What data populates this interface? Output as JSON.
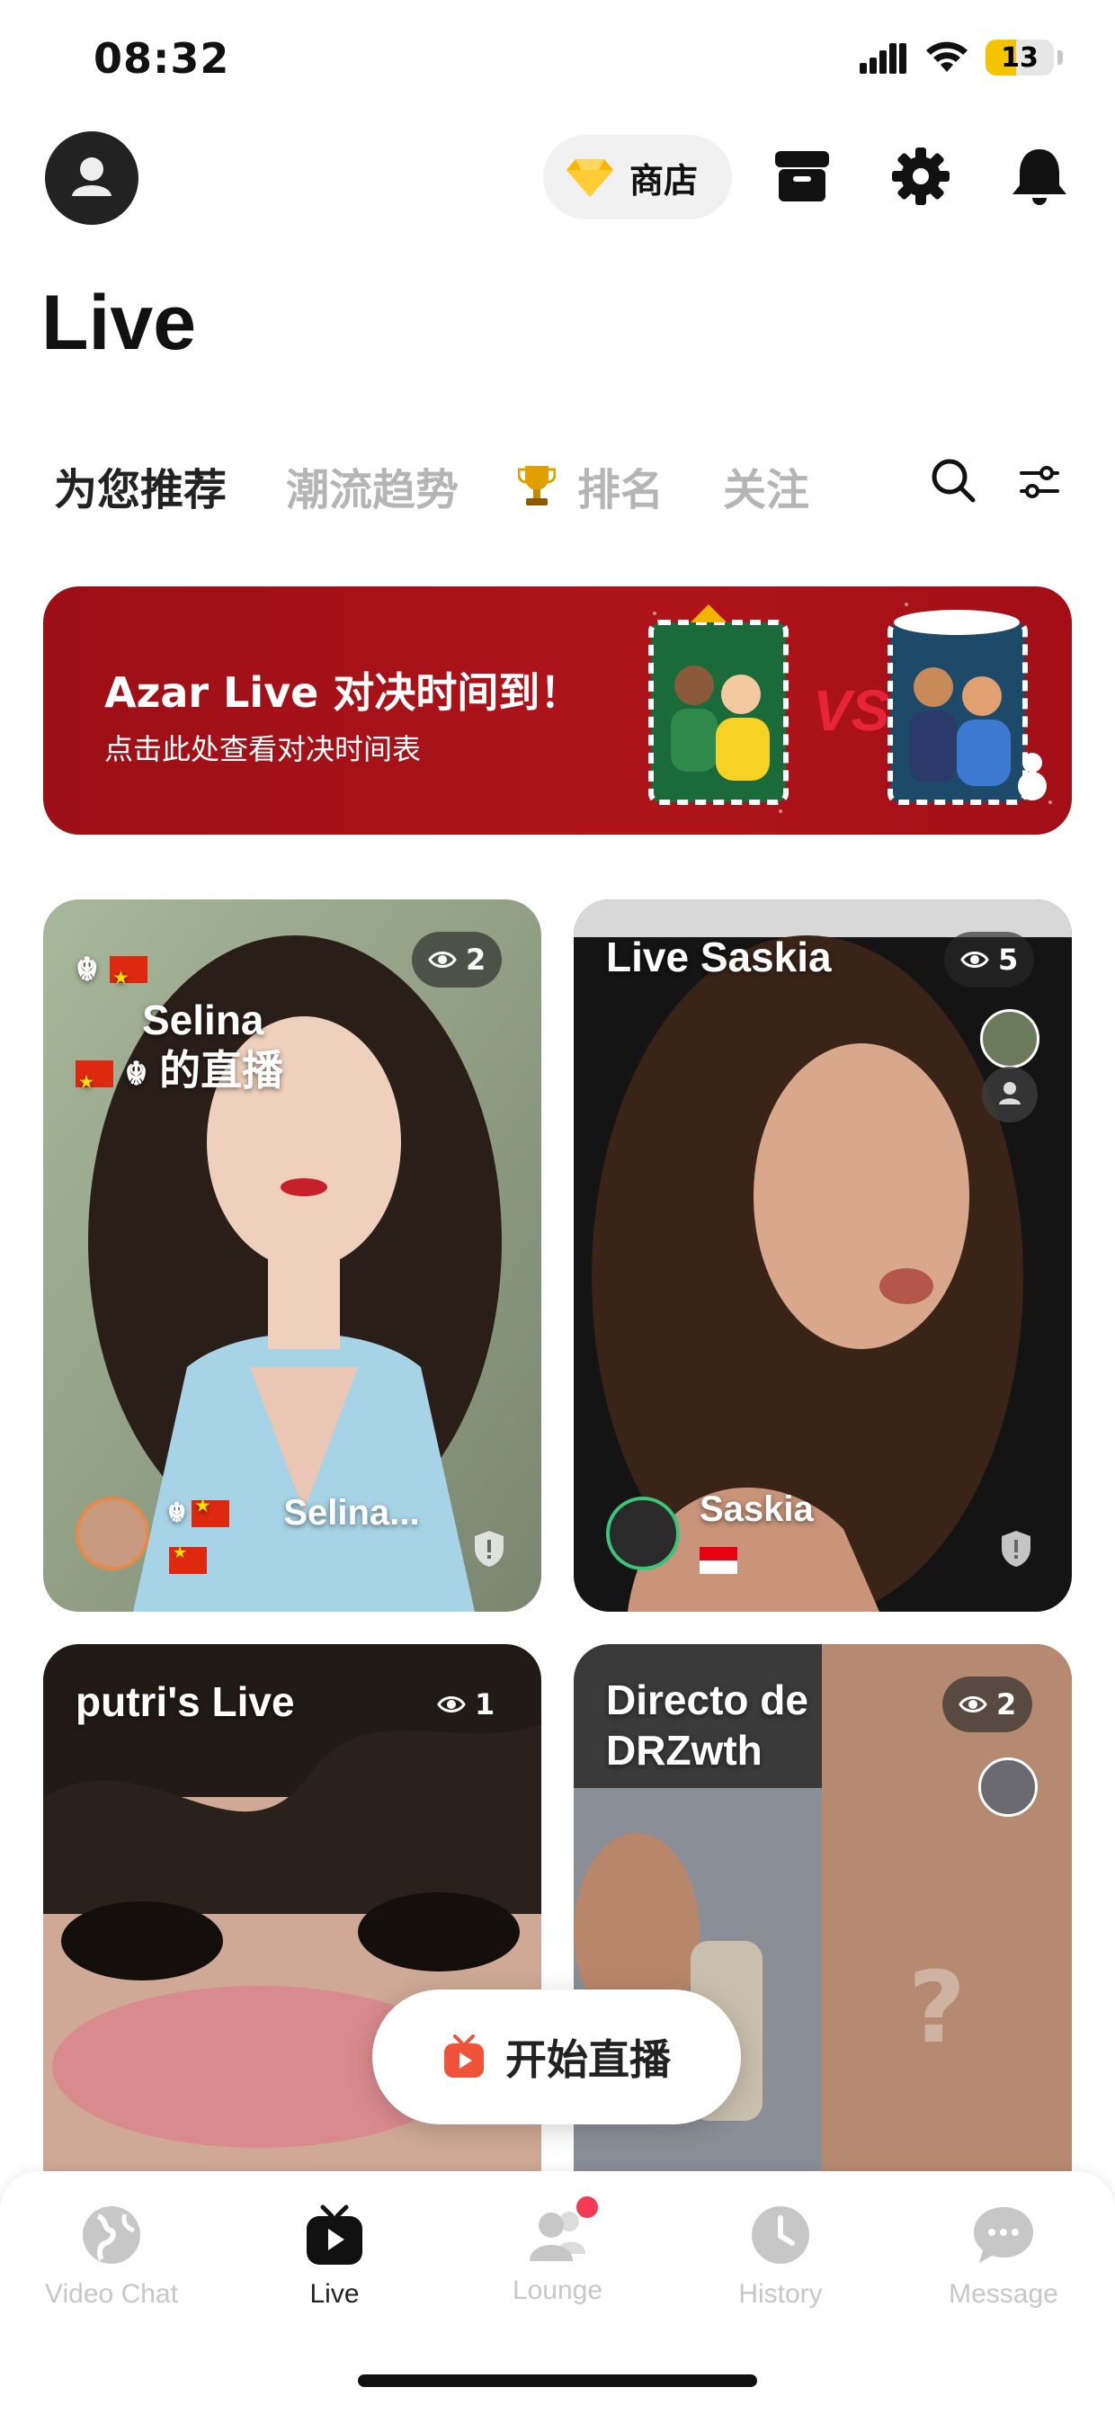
{
  "status_bar": {
    "time": "08:32",
    "battery": "13"
  },
  "header": {
    "shop_label": "商店",
    "page_title": "Live"
  },
  "tabs": [
    {
      "label": "为您推荐",
      "active": true
    },
    {
      "label": "潮流趋势",
      "active": false
    },
    {
      "label": "排名",
      "active": false,
      "icon": "trophy-icon"
    },
    {
      "label": "关注",
      "active": false
    }
  ],
  "banner": {
    "title": "Azar Live 对决时间到！",
    "subtitle": "点击此处查看对决时间表",
    "vs_label": "VS"
  },
  "cards": [
    {
      "title_line1": "Selina",
      "title_line2": "的直播",
      "viewers": "2",
      "host_name": "Selina...",
      "host_flag": "china-flag"
    },
    {
      "title": "Live Saskia",
      "viewers": "5",
      "host_name": "Saskia",
      "host_flag": "indonesia-flag"
    },
    {
      "title": "putri's  Live",
      "viewers": "1"
    },
    {
      "title_line1": "Directo de",
      "title_line2": "DRZwth",
      "viewers": "2",
      "placeholder": "?"
    }
  ],
  "go_live": {
    "label": "开始直播"
  },
  "bottom_nav": [
    {
      "label": "Video Chat",
      "icon": "globe-icon",
      "active": false
    },
    {
      "label": "Live",
      "icon": "tv-icon",
      "active": true
    },
    {
      "label": "Lounge",
      "icon": "people-icon",
      "active": false,
      "badge": true
    },
    {
      "label": "History",
      "icon": "clock-icon",
      "active": false
    },
    {
      "label": "Message",
      "icon": "chat-bubble-icon",
      "active": false
    }
  ],
  "colors": {
    "accent": "#f23b52",
    "banner_red": "#a8121a",
    "online_green": "#3bc47a"
  }
}
